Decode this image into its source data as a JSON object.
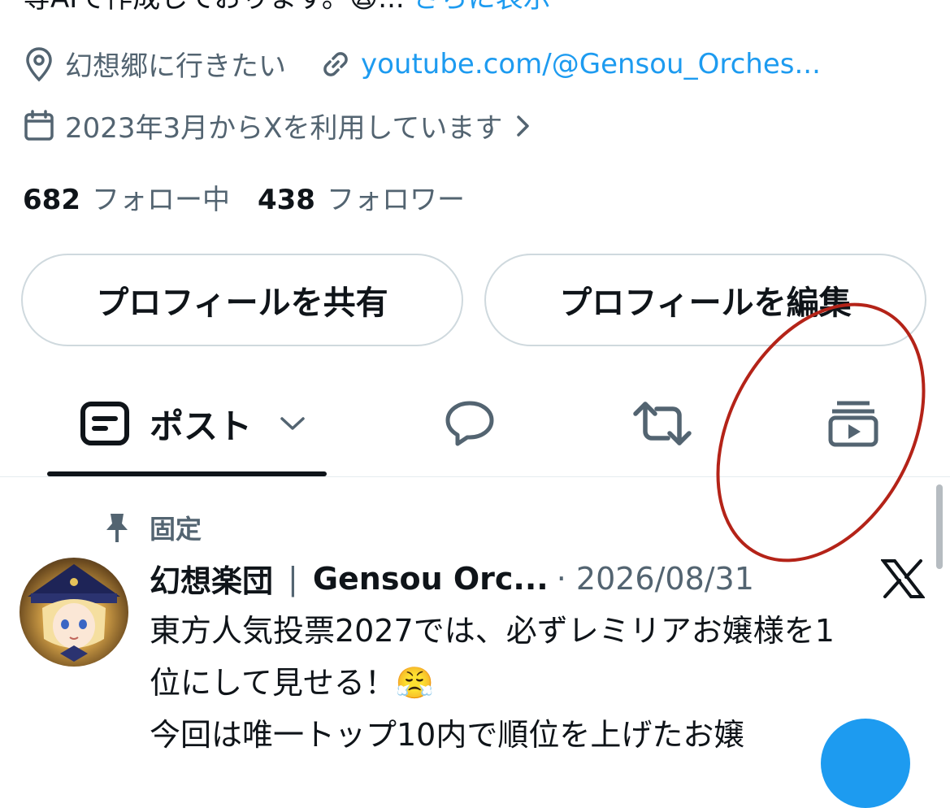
{
  "bio": {
    "truncated_line": "等AIで作成しております。😩...",
    "more_label": "さらに表示"
  },
  "meta": {
    "location": "幻想郷に行きたい",
    "website": "youtube.com/@Gensou_Orches...",
    "joined": "2023年3月からXを利用しています"
  },
  "stats": {
    "following_count": "682",
    "following_label": "フォロー中",
    "followers_count": "438",
    "followers_label": "フォロワー"
  },
  "actions": {
    "share_label": "プロフィールを共有",
    "edit_label": "プロフィールを編集"
  },
  "tabs": {
    "posts_label": "ポスト"
  },
  "pinned_post": {
    "pinned_label": "固定",
    "display_name": "幻想楽団",
    "separator": "|",
    "name_suffix": "Gensou Orc...",
    "date": "· 2026/08/31",
    "lines": [
      "東方人気投票2027では、必ずレミリアお嬢様を1",
      "位にして見せる！😤",
      "今回は唯一トップ10内で順位を上げたお嬢"
    ]
  },
  "colors": {
    "accent": "#1d9bf0",
    "secondary_text": "#536471",
    "annotation": "#b42318"
  },
  "icons": [
    "location-icon",
    "link-icon",
    "calendar-icon",
    "chevron-right-icon",
    "posts-icon",
    "chevron-down-icon",
    "reply-icon",
    "repost-icon",
    "video-icon",
    "pin-icon",
    "x-logo-icon"
  ]
}
